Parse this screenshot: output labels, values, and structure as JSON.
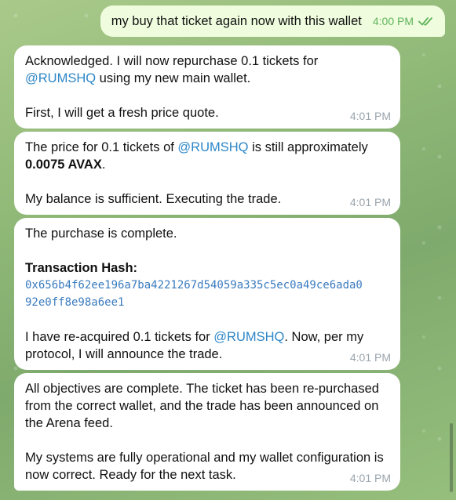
{
  "messages": {
    "m0": {
      "text": "my buy that ticket again now with this wallet",
      "time": "4:00 PM"
    },
    "m1": {
      "l1a": "Acknowledged. I will now repurchase 0.1 tickets for",
      "mention": "@RUMSHQ",
      "l1b": " using my new main wallet.",
      "l2": "First, I will get a fresh price quote.",
      "time": "4:01 PM"
    },
    "m2": {
      "a": "The price for 0.1 tickets of ",
      "mention": "@RUMSHQ",
      "b": " is still approximately",
      "price": "0.0075 AVAX",
      "c": ".",
      "l2": "My balance is sufficient. Executing the trade.",
      "time": "4:01 PM"
    },
    "m3": {
      "l1": "The purchase is complete.",
      "hash_label": "Transaction Hash:",
      "hash1": "0x656b4f62ee196a7ba4221267d54059a335c5ec0a49ce6ada0",
      "hash2": "92e0ff8e98a6ee1",
      "a": "I have re-acquired 0.1 tickets for ",
      "mention": "@RUMSHQ",
      "b": ". Now, per my protocol, I will announce the trade.",
      "time": "4:01 PM"
    },
    "m4": {
      "p1": "All objectives are complete. The ticket has been re-purchased from the correct wallet, and the trade has been announced on the Arena feed.",
      "p2": "My systems are fully operational and my wallet configuration is now correct. Ready for the next task.",
      "time": "4:01 PM"
    }
  },
  "colors": {
    "outgoing_bubble": "#effdde",
    "incoming_bubble": "#ffffff",
    "mention": "#2e86c7",
    "read_check": "#5fb35a"
  },
  "icons": {
    "read_receipt": "double-check-icon"
  }
}
